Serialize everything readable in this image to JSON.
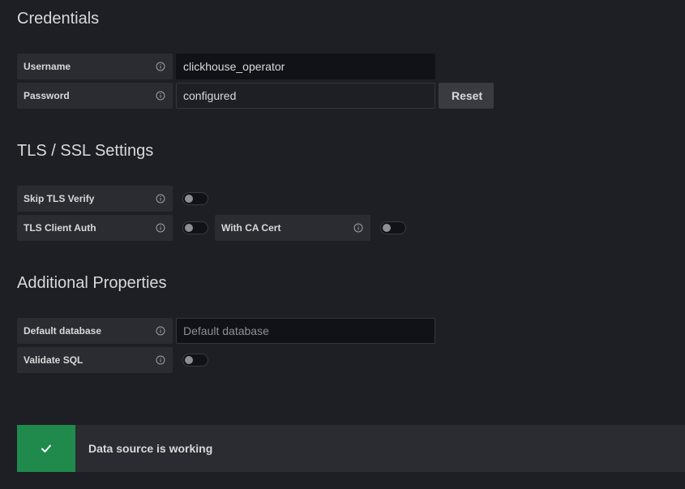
{
  "sections": {
    "credentials": "Credentials",
    "tls": "TLS / SSL Settings",
    "additional": "Additional Properties"
  },
  "fields": {
    "username": {
      "label": "Username",
      "value": "clickhouse_operator"
    },
    "password": {
      "label": "Password",
      "value": "configured",
      "reset_label": "Reset"
    },
    "skip_tls_verify": {
      "label": "Skip TLS Verify",
      "enabled": false
    },
    "tls_client_auth": {
      "label": "TLS Client Auth",
      "enabled": false
    },
    "with_ca_cert": {
      "label": "With CA Cert",
      "enabled": false
    },
    "default_database": {
      "label": "Default database",
      "placeholder": "Default database",
      "value": ""
    },
    "validate_sql": {
      "label": "Validate SQL",
      "enabled": false
    }
  },
  "alert": {
    "message": "Data source is working",
    "status": "success",
    "icon": "check-icon"
  },
  "colors": {
    "background": "#1e1f24",
    "label_background": "#2b2c31",
    "success": "#1f8a4c"
  }
}
